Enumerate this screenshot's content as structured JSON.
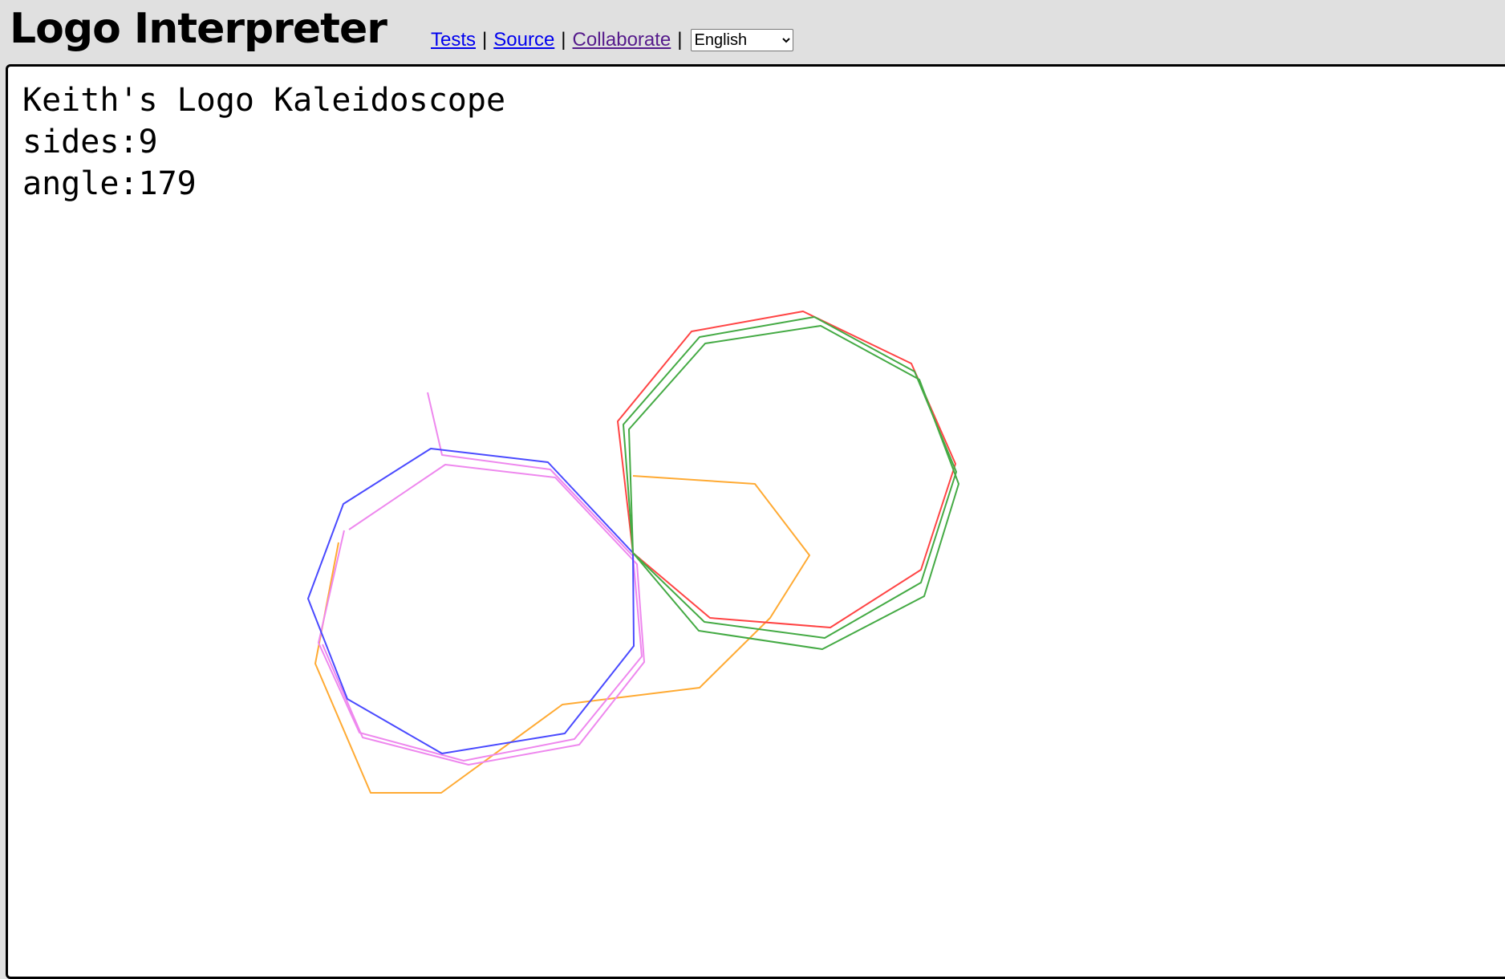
{
  "header": {
    "title": "Logo Interpreter",
    "links": [
      {
        "label": "Tests"
      },
      {
        "label": "Source"
      },
      {
        "label": "Collaborate"
      }
    ],
    "separator": "|",
    "language": {
      "selected": "English",
      "options": [
        "English"
      ]
    }
  },
  "output": {
    "lines": [
      "Keith's Logo Kaleidoscope",
      "sides:9",
      "angle:179"
    ]
  },
  "drawing": {
    "shape": "nonagon",
    "sides": 9,
    "colors": {
      "blue": "#4a4aff",
      "violet": "#ee88ee",
      "orange": "#ffaa33",
      "red": "#ff4444",
      "green": "#44aa44"
    }
  }
}
